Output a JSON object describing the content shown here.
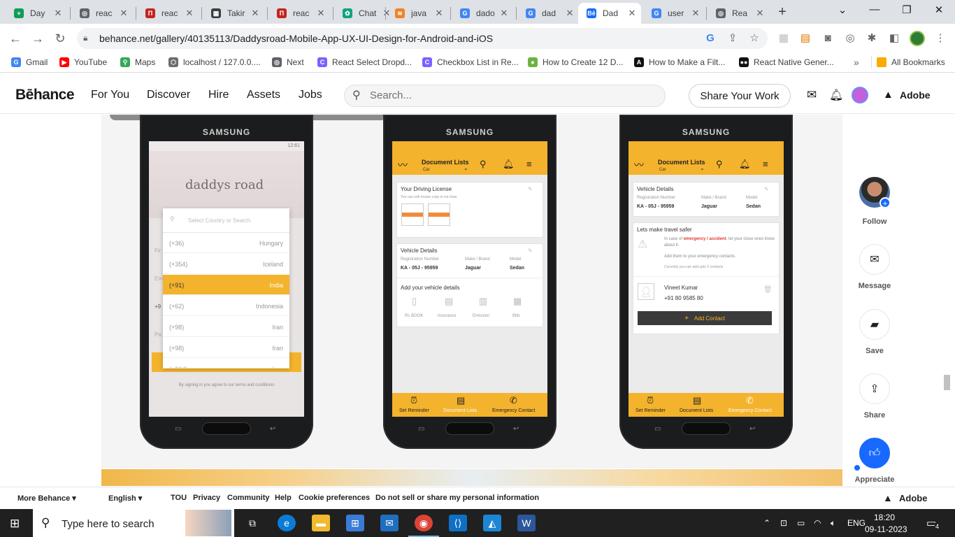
{
  "tabs": [
    {
      "title": "Day",
      "color": "#0f9d58",
      "glyph": "+"
    },
    {
      "title": "reac",
      "color": "#5f6368",
      "glyph": "◎"
    },
    {
      "title": "reac",
      "color": "#c5221f",
      "glyph": "П"
    },
    {
      "title": "Takir",
      "color": "#3c4043",
      "glyph": "▦"
    },
    {
      "title": "reac",
      "color": "#c5221f",
      "glyph": "П"
    },
    {
      "title": "Chat",
      "color": "#10a37f",
      "glyph": "✿"
    },
    {
      "title": "java",
      "color": "#f48024",
      "glyph": "≋"
    },
    {
      "title": "dado",
      "color": "#4285f4",
      "glyph": "G"
    },
    {
      "title": "dad",
      "color": "#4285f4",
      "glyph": "G"
    },
    {
      "title": "Dad",
      "color": "#1769ff",
      "glyph": "Bē"
    },
    {
      "title": "user",
      "color": "#4285f4",
      "glyph": "G"
    },
    {
      "title": "Rea",
      "color": "#5f6368",
      "glyph": "◎"
    }
  ],
  "url": "behance.net/gallery/40135113/Daddysroad-Mobile-App-UX-UI-Design-for-Android-and-iOS",
  "bookmarks": [
    {
      "label": "Gmail",
      "color": "#4285f4",
      "glyph": "G"
    },
    {
      "label": "YouTube",
      "color": "#ff0000",
      "glyph": "▶"
    },
    {
      "label": "Maps",
      "color": "#34a853",
      "glyph": "⚲"
    },
    {
      "label": "localhost / 127.0.0....",
      "color": "#6c6c6c",
      "glyph": "⬡"
    },
    {
      "label": "Next",
      "color": "#5f6368",
      "glyph": "◎"
    },
    {
      "label": "React Select Dropd...",
      "color": "#7b61ff",
      "glyph": "C"
    },
    {
      "label": "Checkbox List in Re...",
      "color": "#7b61ff",
      "glyph": "C"
    },
    {
      "label": "How to Create 12 D...",
      "color": "#6db33f",
      "glyph": "●"
    },
    {
      "label": "How to Make a Filt...",
      "color": "#111111",
      "glyph": "A"
    },
    {
      "label": "React Native Gener...",
      "color": "#111111",
      "glyph": "●●"
    }
  ],
  "all_bookmarks": "All Bookmarks",
  "more_bookmarks": "»",
  "behance": {
    "logo": "Bēhance",
    "nav": [
      "For You",
      "Discover",
      "Hire",
      "Assets",
      "Jobs"
    ],
    "search_placeholder": "Search...",
    "share_work": "Share Your Work",
    "adobe": "Adobe"
  },
  "phone1": {
    "brand": "SAMSUNG",
    "status_time": "12:61",
    "logo_text": "daddys road",
    "search_placeholder": "Select Country or Search",
    "countries": [
      {
        "code": "(+36)",
        "name": "Hungary",
        "selected": false
      },
      {
        "code": "(+354)",
        "name": "Iceland",
        "selected": false
      },
      {
        "code": "(+91)",
        "name": "India",
        "selected": true
      },
      {
        "code": "(+62)",
        "name": "Indonesia",
        "selected": false
      },
      {
        "code": "(+98)",
        "name": "Iran",
        "selected": false
      },
      {
        "code": "(+98)",
        "name": "Iran",
        "selected": false
      },
      {
        "code": "(+964)",
        "name": "Iraq",
        "selected": false
      }
    ],
    "terms": "By signing in you agree to our terms and conditions",
    "peek": [
      "Fir",
      "Em",
      "+9",
      "Pa"
    ]
  },
  "phone2": {
    "brand": "SAMSUNG",
    "title": "Document Lists",
    "subtitle": "Car",
    "card1_title": "Your Driving License",
    "card1_sub": "You can edit incase copy is not clear",
    "card2_title": "Vehicle Details",
    "labels": [
      "Registration Number",
      "Make / Brand",
      "Model"
    ],
    "values": [
      "KA - 05J - 95959",
      "Jaguar",
      "Sedan"
    ],
    "add_details": "Add your vehicle details",
    "docs": [
      "Rc BOOK",
      "Insurance",
      "Emission",
      "Bills"
    ],
    "bottom": [
      "Set Reminder",
      "Document Lists",
      "Emergency Contact"
    ]
  },
  "phone3": {
    "brand": "SAMSUNG",
    "title": "Document Lists",
    "subtitle": "Car",
    "card1_title": "Vehicle Details",
    "labels": [
      "Registration Number",
      "Make / Brand",
      "Model"
    ],
    "values": [
      "KA - 05J - 95959",
      "Jaguar",
      "Sedan"
    ],
    "card2_title": "Lets make travel safer",
    "safer_pre": "In case of ",
    "safer_em": "emergency / accident",
    "safer_post": ", let your close ones know about it.",
    "add_them": "Add them to your emergency contacts.",
    "upto": "Currently you can add upto 2 contacts",
    "contact_name": "Vineet Kumar",
    "contact_phone": "+91 80 9585 80",
    "add_contact": "Add Contact",
    "bottom": [
      "Set Reminder",
      "Document Lists",
      "Emergency Contact"
    ]
  },
  "rail": {
    "follow": "Follow",
    "message": "Message",
    "save": "Save",
    "share": "Share",
    "appreciate": "Appreciate"
  },
  "footer": {
    "more": "More Behance ▾",
    "lang": "English ▾",
    "links": [
      "TOU",
      "Privacy",
      "Community",
      "Help",
      "Cookie preferences",
      "Do not sell or share my personal information"
    ],
    "adobe": "Adobe"
  },
  "taskbar": {
    "search": "Type here to search",
    "lang": "ENG",
    "time": "18:20",
    "date": "09-11-2023",
    "notif": "4"
  }
}
